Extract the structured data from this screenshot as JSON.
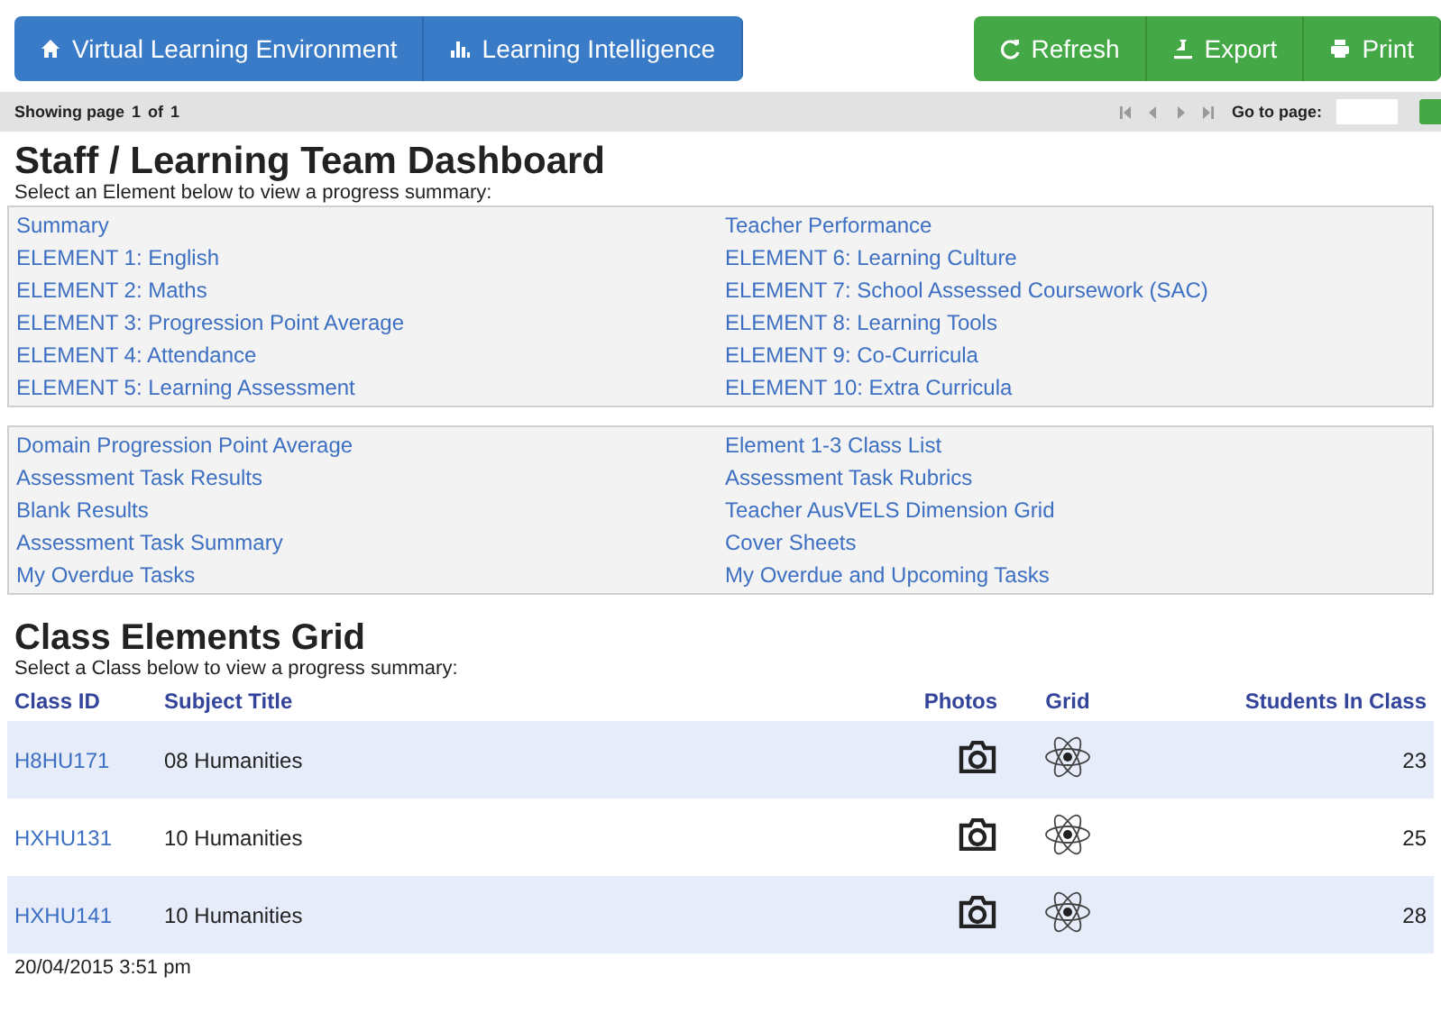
{
  "nav_left": [
    {
      "kind": "home",
      "label": "Virtual Learning Environment"
    },
    {
      "kind": "chart",
      "label": "Learning Intelligence"
    }
  ],
  "nav_right": [
    {
      "kind": "refresh",
      "label": "Refresh"
    },
    {
      "kind": "export",
      "label": "Export"
    },
    {
      "kind": "print",
      "label": "Print"
    }
  ],
  "pager": {
    "showing": "Showing page",
    "page": "1",
    "of": "of",
    "total": "1",
    "goto_label": "Go to page:"
  },
  "dashboard": {
    "title": "Staff / Learning Team Dashboard",
    "subtitle": "Select an Element below to view a progress summary:",
    "groups": [
      {
        "left": [
          "Summary",
          "ELEMENT 1: English",
          "ELEMENT 2: Maths",
          "ELEMENT 3: Progression Point Average",
          "ELEMENT 4: Attendance",
          "ELEMENT 5: Learning Assessment"
        ],
        "right": [
          "Teacher Performance",
          "ELEMENT 6: Learning Culture",
          "ELEMENT 7: School Assessed Coursework (SAC)",
          "ELEMENT 8: Learning Tools",
          "ELEMENT 9: Co-Curricula",
          "ELEMENT 10: Extra Curricula"
        ]
      },
      {
        "left": [
          "Domain Progression Point Average",
          "Assessment Task Results",
          "Blank Results",
          "Assessment Task Summary",
          "My Overdue Tasks"
        ],
        "right": [
          "Element 1-3 Class List",
          "Assessment Task Rubrics",
          "Teacher AusVELS Dimension Grid",
          "Cover Sheets",
          "My Overdue and Upcoming Tasks"
        ]
      }
    ]
  },
  "class_grid": {
    "title": "Class Elements Grid",
    "subtitle": "Select a Class below to view a progress summary:",
    "columns": [
      "Class ID",
      "Subject Title",
      "Photos",
      "Grid",
      "Students In Class"
    ],
    "rows": [
      {
        "class_id": "H8HU171",
        "subject": "08 Humanities",
        "students": "23"
      },
      {
        "class_id": "HXHU131",
        "subject": "10 Humanities",
        "students": "25"
      },
      {
        "class_id": "HXHU141",
        "subject": "10 Humanities",
        "students": "28"
      }
    ]
  },
  "timestamp": "20/04/2015 3:51 pm"
}
